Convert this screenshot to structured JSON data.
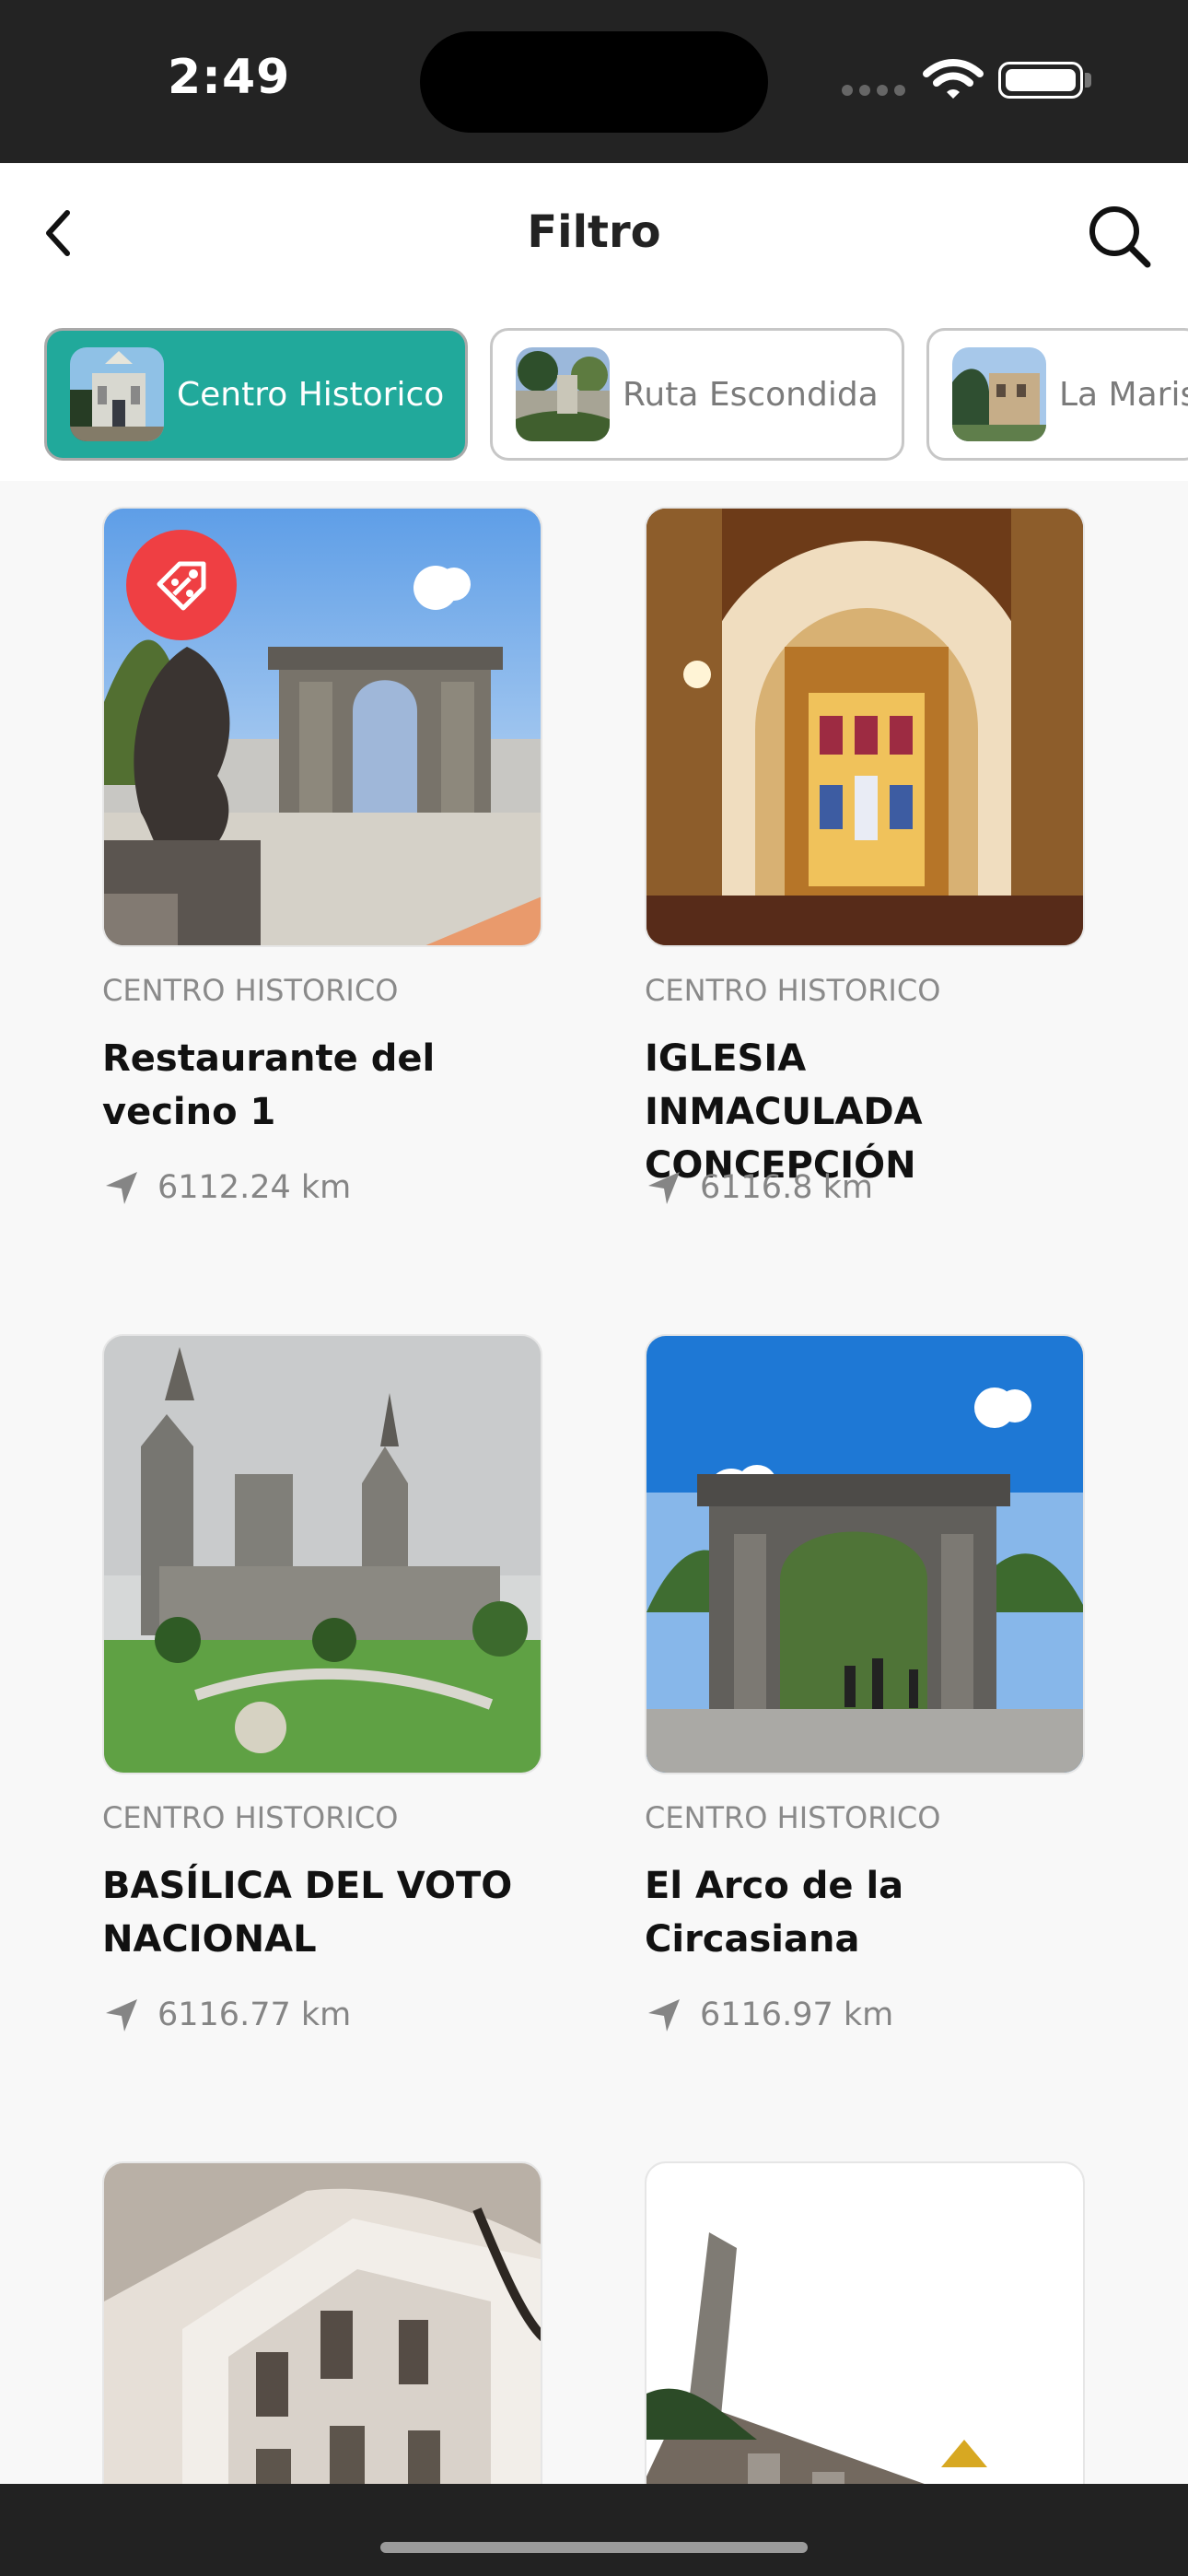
{
  "status_bar": {
    "time": "2:49"
  },
  "header": {
    "title": "Filtro"
  },
  "filters": [
    {
      "label": "Centro Historico",
      "active": true,
      "icon": "historic-center-thumbnail"
    },
    {
      "label": "Ruta Escondida",
      "active": false,
      "icon": "hidden-route-thumbnail"
    },
    {
      "label": "La Maris",
      "active": false,
      "icon": "la-maris-thumbnail"
    }
  ],
  "places": [
    {
      "category": "CENTRO HISTORICO",
      "name": "Restaurante del vecino 1",
      "distance": "6112.24 km",
      "badge": "discount-tag-icon"
    },
    {
      "category": "CENTRO HISTORICO",
      "name": "IGLESIA INMACULADA CONCEPCIÓN",
      "distance": "6116.8 km"
    },
    {
      "category": "CENTRO HISTORICO",
      "name": "BASÍLICA DEL VOTO NACIONAL",
      "distance": "6116.77 km"
    },
    {
      "category": "CENTRO HISTORICO",
      "name": "El Arco de la Circasiana",
      "distance": "6116.97 km"
    }
  ],
  "colors": {
    "accent": "#21a99b",
    "badge": "#ef3f43"
  }
}
